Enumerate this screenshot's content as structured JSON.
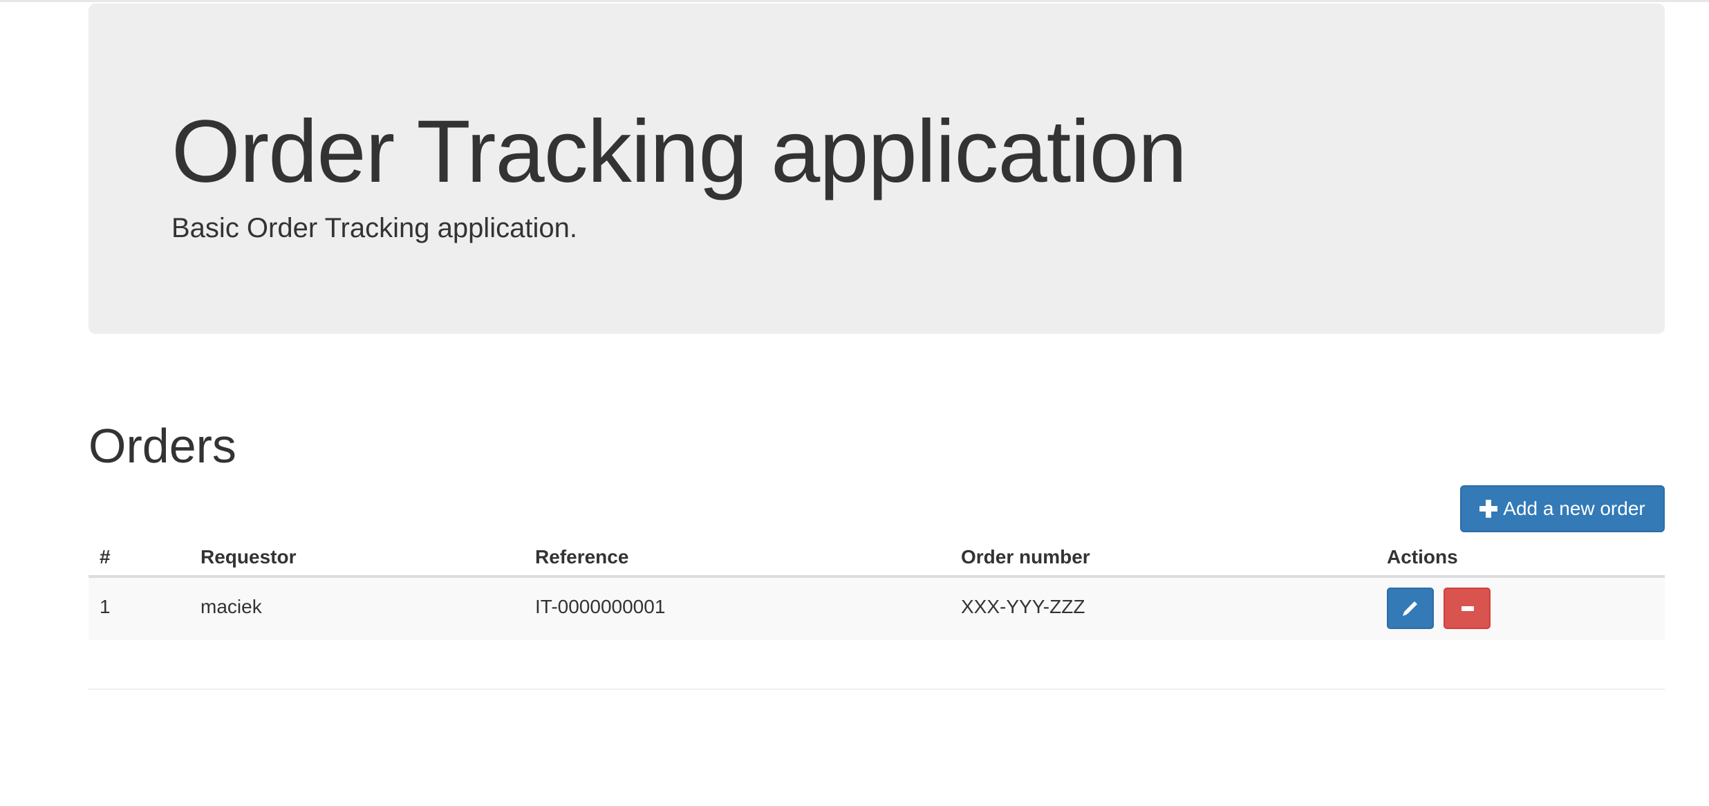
{
  "jumbotron": {
    "title": "Order Tracking application",
    "subtitle": "Basic Order Tracking application."
  },
  "orders_section": {
    "heading": "Orders",
    "add_button_label": "Add a new order",
    "add_button_icon": "plus-icon",
    "table": {
      "headers": [
        "#",
        "Requestor",
        "Reference",
        "Order number",
        "Actions"
      ],
      "rows": [
        {
          "num": "1",
          "requestor": "maciek",
          "reference": "IT-0000000001",
          "order_number": "XXX-YYY-ZZZ",
          "actions": [
            {
              "name": "edit",
              "icon": "pencil-icon",
              "color": "#337ab7"
            },
            {
              "name": "delete",
              "icon": "minus-icon",
              "color": "#d9534f"
            }
          ]
        }
      ]
    }
  },
  "colors": {
    "jumbotron_bg": "#eeeeee",
    "primary": "#337ab7",
    "danger": "#d9534f",
    "text": "#333333"
  }
}
